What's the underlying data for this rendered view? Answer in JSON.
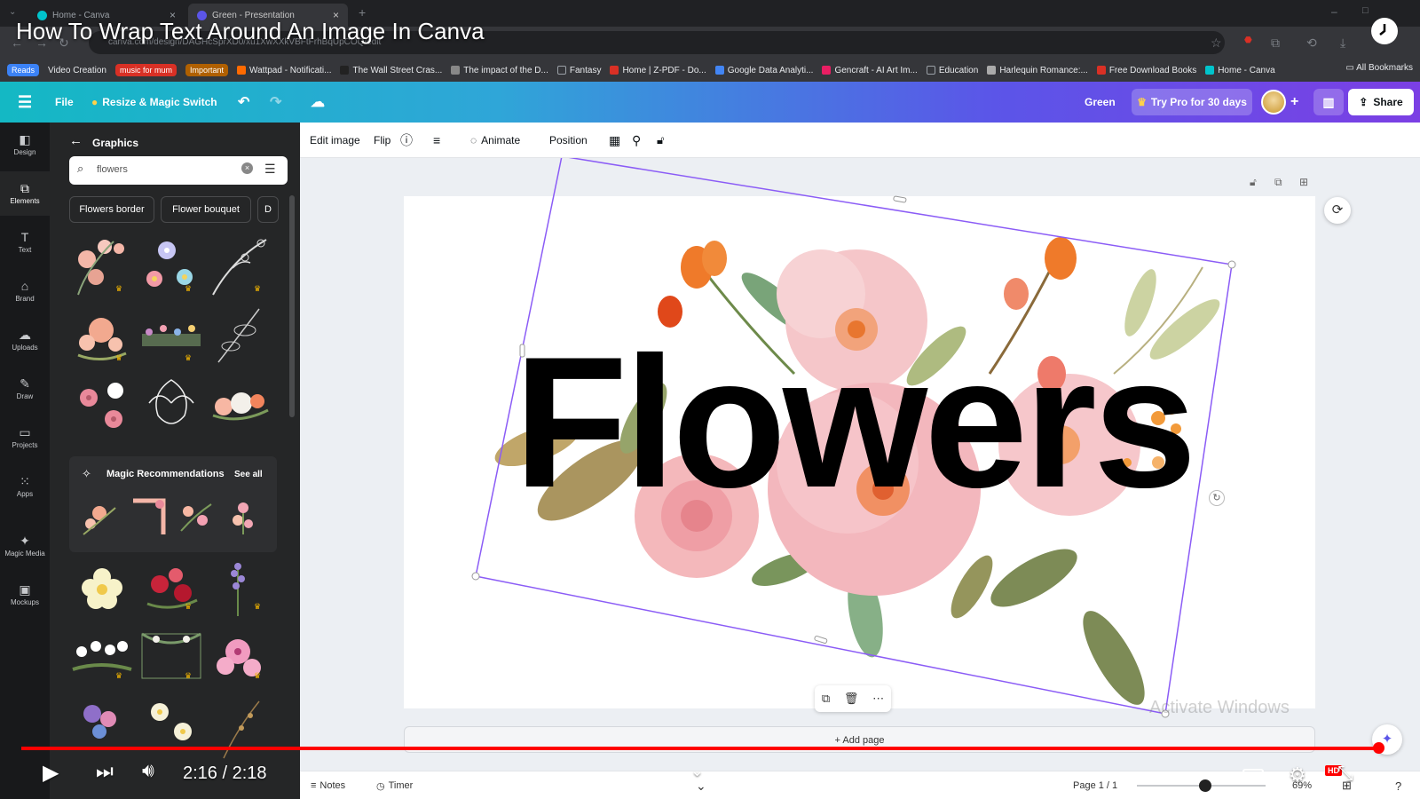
{
  "browser": {
    "tabs": [
      {
        "title": "Home - Canva",
        "active": false
      },
      {
        "title": "Green - Presentation",
        "active": true
      }
    ],
    "url": "canva.com/design/DAGHcSprXD0/xu1XwXXkVBFtFrhBqUpCOQ/edit",
    "bookmarks": [
      {
        "label": "Reads",
        "color": "#3b82f6",
        "type": "pill"
      },
      {
        "label": "Video Creation",
        "type": "text"
      },
      {
        "label": "music for mum",
        "color": "#d93025",
        "type": "pill"
      },
      {
        "label": "Important",
        "color": "#b06000",
        "type": "pill"
      },
      {
        "label": "Wattpad - Notificati...",
        "color": "#ff6a00",
        "type": "link"
      },
      {
        "label": "The Wall Street Cras...",
        "color": "#222222",
        "type": "link"
      },
      {
        "label": "The impact of the D...",
        "color": "#888888",
        "type": "link"
      },
      {
        "label": "Fantasy",
        "color": "#9aa0a6",
        "type": "folder"
      },
      {
        "label": "Home | Z-PDF - Do...",
        "color": "#d93025",
        "type": "link"
      },
      {
        "label": "Google Data Analyti...",
        "color": "#4285f4",
        "type": "link"
      },
      {
        "label": "Gencraft - AI Art Im...",
        "color": "#e91e63",
        "type": "link"
      },
      {
        "label": "Education",
        "color": "#9aa0a6",
        "type": "folder"
      },
      {
        "label": "Harlequin Romance:...",
        "color": "#aaaaaa",
        "type": "link"
      },
      {
        "label": "Free Download Books",
        "color": "#d93025",
        "type": "link"
      },
      {
        "label": "Home - Canva",
        "color": "#00c4cc",
        "type": "link"
      }
    ],
    "all_bookmarks": "All Bookmarks"
  },
  "canva_top": {
    "file": "File",
    "resize": "Resize & Magic Switch",
    "design_name": "Green",
    "try_pro": "Try Pro for 30 days",
    "share": "Share"
  },
  "rail": [
    {
      "label": "Design",
      "icon": "design-icon",
      "glyph": "◧"
    },
    {
      "label": "Elements",
      "icon": "elements-icon",
      "glyph": "⧉",
      "active": true
    },
    {
      "label": "Text",
      "icon": "text-icon",
      "glyph": "T"
    },
    {
      "label": "Brand",
      "icon": "brand-icon",
      "glyph": "⌂"
    },
    {
      "label": "Uploads",
      "icon": "uploads-icon",
      "glyph": "☁"
    },
    {
      "label": "Draw",
      "icon": "draw-icon",
      "glyph": "✎"
    },
    {
      "label": "Projects",
      "icon": "projects-icon",
      "glyph": "▭"
    },
    {
      "label": "Apps",
      "icon": "apps-icon",
      "glyph": "⁙"
    },
    {
      "label": "Magic Media",
      "icon": "magic-media-icon",
      "glyph": "✦"
    },
    {
      "label": "Mockups",
      "icon": "mockups-icon",
      "glyph": "▣"
    }
  ],
  "panel": {
    "title": "Graphics",
    "search_value": "flowers",
    "chips": [
      "Flowers border",
      "Flower bouquet",
      "D"
    ],
    "magic_title": "Magic Recommendations",
    "see_all": "See all"
  },
  "toolbar": {
    "edit_image": "Edit image",
    "flip": "Flip",
    "animate": "Animate",
    "position": "Position"
  },
  "canvas": {
    "headline": "Flowers",
    "add_page": "+ Add page",
    "watermark": "Activate Windows"
  },
  "bottom_bar": {
    "notes": "Notes",
    "timer": "Timer",
    "page": "Page 1 / 1",
    "zoom": "69%"
  },
  "video": {
    "title": "How To Wrap Text Around An Image In Canva",
    "current_time": "2:16",
    "duration": "2:18",
    "time_display": "2:16 / 2:18",
    "progress": 0.985,
    "cc": "CC",
    "hd": "HD"
  },
  "colors": {
    "canva_gradient_start": "#14b8c4",
    "canva_gradient_end": "#7b3fe4",
    "selection": "#8b5cf6",
    "progress": "#ff0000"
  }
}
